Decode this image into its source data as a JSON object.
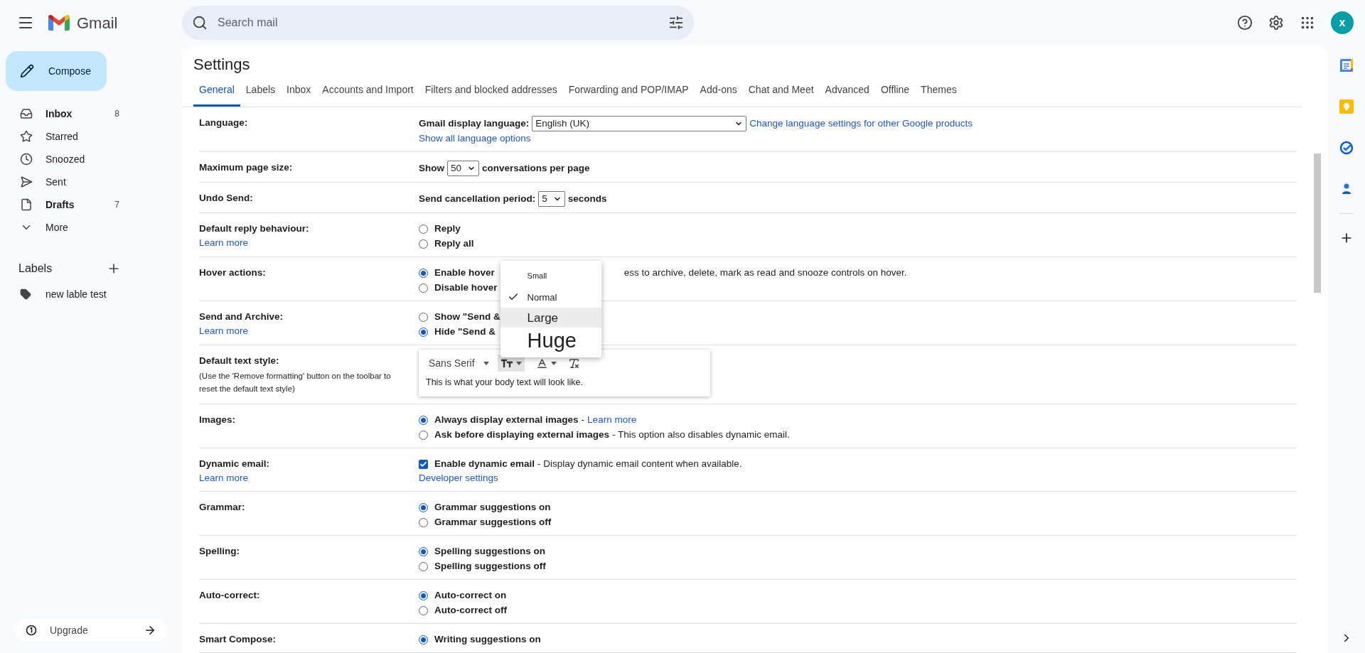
{
  "header": {
    "app_name": "Gmail",
    "search": {
      "placeholder": "Search mail"
    },
    "avatar": "x"
  },
  "sidebar": {
    "compose": "Compose",
    "items": [
      {
        "label": "Inbox",
        "count": "8",
        "unread": true,
        "kind": "inbox"
      },
      {
        "label": "Starred",
        "unread": false,
        "kind": "starred"
      },
      {
        "label": "Snoozed",
        "unread": false,
        "kind": "snoozed"
      },
      {
        "label": "Sent",
        "unread": false,
        "kind": "sent"
      },
      {
        "label": "Drafts",
        "count": "7",
        "unread": true,
        "kind": "drafts"
      },
      {
        "label": "More",
        "unread": false,
        "kind": "more"
      }
    ],
    "labels_title": "Labels",
    "labels": [
      {
        "label": "new lable test"
      }
    ],
    "upgrade": "Upgrade"
  },
  "settings": {
    "title": "Settings",
    "tabs": [
      {
        "label": "General",
        "selected": true
      },
      {
        "label": "Labels",
        "selected": false
      },
      {
        "label": "Inbox",
        "selected": false
      },
      {
        "label": "Accounts and Import",
        "selected": false
      },
      {
        "label": "Filters and blocked addresses",
        "selected": false
      },
      {
        "label": "Forwarding and POP/IMAP",
        "selected": false
      },
      {
        "label": "Add-ons",
        "selected": false
      },
      {
        "label": "Chat and Meet",
        "selected": false
      },
      {
        "label": "Advanced",
        "selected": false
      },
      {
        "label": "Offline",
        "selected": false
      },
      {
        "label": "Themes",
        "selected": false
      }
    ],
    "rows": [
      {
        "kind": "language",
        "label": "Language:",
        "field_label": "Gmail display language:",
        "value": "English (UK)",
        "settings_link": "Change language settings for other Google products",
        "sublink": "Show all language options"
      },
      {
        "kind": "select",
        "label": "Maximum page size:",
        "before": "Show",
        "value": "50",
        "after": "conversations per page"
      },
      {
        "kind": "select",
        "label": "Undo Send:",
        "before": "Send cancellation period:",
        "value": "5",
        "after": "seconds"
      },
      {
        "kind": "radio",
        "label": "Default reply behaviour:",
        "link": "Learn more",
        "options": [
          {
            "text": "Reply",
            "selected": false
          },
          {
            "text": "Reply all",
            "selected": false
          }
        ]
      },
      {
        "kind": "radio",
        "label": "Hover actions:",
        "options": [
          {
            "text": "Enable hover",
            "selected": true,
            "description": "ess to archive, delete, mark as read and snooze controls on hover.",
            "covered": true
          },
          {
            "text": "Disable hover",
            "selected": false
          }
        ]
      },
      {
        "kind": "radio",
        "label": "Send and Archive:",
        "link": "Learn more",
        "options": [
          {
            "text": "Show \"Send &",
            "selected": false
          },
          {
            "text": "Hide \"Send &",
            "selected": true
          }
        ]
      },
      {
        "kind": "text_style",
        "label": "Default text style:",
        "note": "(Use the 'Remove formatting' button on the toolbar to reset the default text style)",
        "font": "Sans Serif",
        "sample": "This is what your body text will look like.",
        "size_menu": [
          {
            "label": "Small",
            "kind": "small",
            "selected": false,
            "highlighted": false
          },
          {
            "label": "Normal",
            "kind": "normal",
            "selected": true,
            "highlighted": false
          },
          {
            "label": "Large",
            "kind": "large",
            "selected": false,
            "highlighted": true
          },
          {
            "label": "Huge",
            "kind": "huge",
            "selected": false,
            "highlighted": false
          }
        ]
      },
      {
        "kind": "radio",
        "label": "Images:",
        "options": [
          {
            "text": "Always display external images",
            "selected": true,
            "description": "-",
            "link": "Learn more"
          },
          {
            "text": "Ask before displaying external images",
            "selected": false,
            "description": "- This option also disables dynamic email."
          }
        ]
      },
      {
        "kind": "checkbox",
        "label": "Dynamic email:",
        "link": "Learn more",
        "option": {
          "text": "Enable dynamic email",
          "checked": true,
          "description": "- Display dynamic email content when available."
        },
        "sublink": "Developer settings"
      },
      {
        "kind": "radio",
        "label": "Grammar:",
        "options": [
          {
            "text": "Grammar suggestions on",
            "selected": true
          },
          {
            "text": "Grammar suggestions off",
            "selected": false
          }
        ]
      },
      {
        "kind": "radio",
        "label": "Spelling:",
        "options": [
          {
            "text": "Spelling suggestions on",
            "selected": true
          },
          {
            "text": "Spelling suggestions off",
            "selected": false
          }
        ]
      },
      {
        "kind": "radio",
        "label": "Auto-correct:",
        "options": [
          {
            "text": "Auto-correct on",
            "selected": true
          },
          {
            "text": "Auto-correct off",
            "selected": false
          }
        ]
      },
      {
        "kind": "radio",
        "label": "Smart Compose:",
        "options": [
          {
            "text": "Writing suggestions on",
            "selected": true
          }
        ]
      }
    ]
  }
}
